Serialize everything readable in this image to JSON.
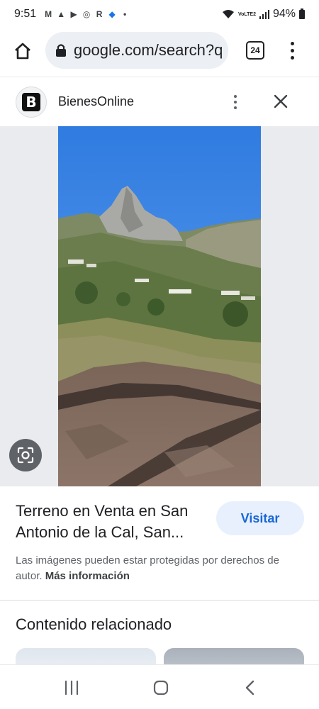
{
  "status_bar": {
    "time": "9:51",
    "notifications": [
      "M",
      "▲",
      "▶",
      "◎",
      "R",
      "◆",
      "•"
    ],
    "network_label": "VoLTE2",
    "battery": "94%"
  },
  "browser": {
    "url": "google.com/search?q",
    "tab_count": "24"
  },
  "result": {
    "site_initial": "B",
    "site_name": "BienesOnline",
    "title_line1": "Terreno en Venta en San",
    "title_line2": "Antonio de la Cal, San...",
    "visit_label": "Visitar",
    "disclaimer": "Las imágenes pueden estar protegidas por derechos de autor.",
    "more_info": "Más información",
    "related_title": "Contenido relacionado"
  },
  "icons": {
    "home": "home-icon",
    "lock": "lock-icon",
    "menu": "more-vert-icon",
    "close": "close-icon",
    "lens": "google-lens-icon",
    "nav_recent": "recent-apps-icon",
    "nav_home": "nav-home-icon",
    "nav_back": "back-icon"
  },
  "colors": {
    "accent": "#1967d2",
    "visit_bg": "#e8f0fe",
    "url_bar_bg": "#eceff3",
    "sky": "#3f86e6"
  }
}
